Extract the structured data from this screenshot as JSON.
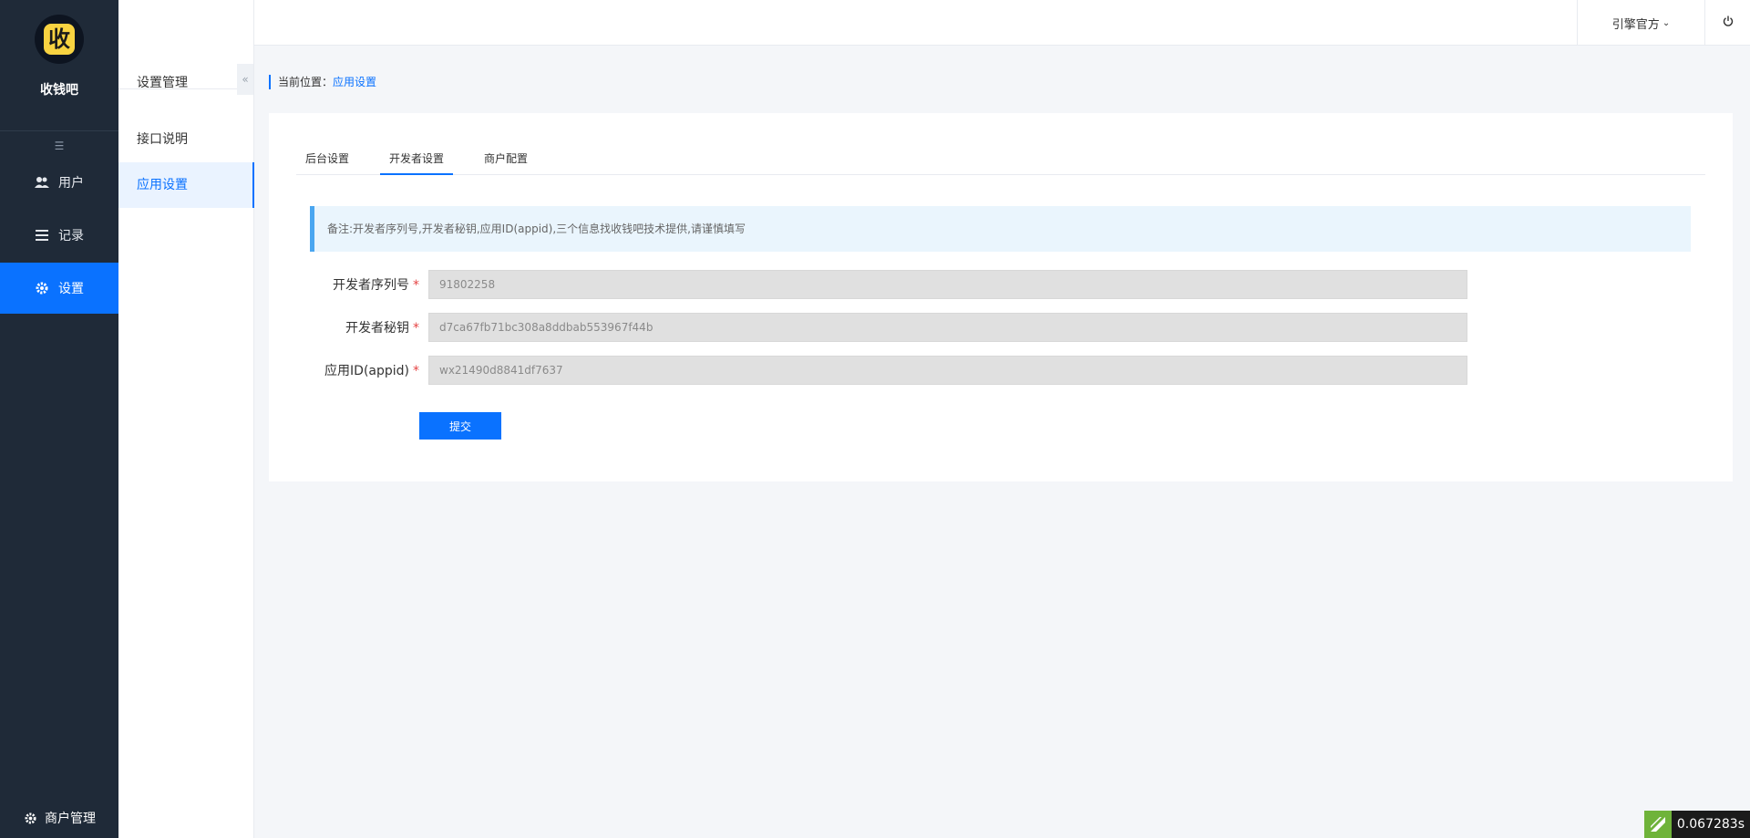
{
  "brand": {
    "logo_char": "收",
    "name": "收钱吧"
  },
  "sidebar": {
    "items": [
      {
        "label": "用户",
        "icon": "users-icon"
      },
      {
        "label": "记录",
        "icon": "list-icon"
      },
      {
        "label": "设置",
        "icon": "gear-icon",
        "active": true
      }
    ],
    "bottom_label": "商户管理"
  },
  "subnav": {
    "title": "设置管理",
    "items": [
      {
        "label": "接口说明"
      },
      {
        "label": "应用设置",
        "active": true
      }
    ]
  },
  "topbar": {
    "user": "引擎官方"
  },
  "breadcrumb": {
    "prefix": "当前位置：",
    "current": "应用设置"
  },
  "tabs": [
    {
      "label": "后台设置"
    },
    {
      "label": "开发者设置",
      "active": true
    },
    {
      "label": "商户配置"
    }
  ],
  "notice": "备注:开发者序列号,开发者秘钥,应用ID(appid),三个信息找收钱吧技术提供,请谨慎填写",
  "form": {
    "fields": [
      {
        "label": "开发者序列号",
        "value": "91802258"
      },
      {
        "label": "开发者秘钥",
        "value": "d7ca67fb71bc308a8ddbab553967f44b"
      },
      {
        "label": "应用ID(appid)",
        "value": "wx21490d8841df7637"
      }
    ],
    "required_mark": "*",
    "submit_label": "提交"
  },
  "timer": "0.067283s",
  "colors": {
    "sidebar_bg": "#1f2a38",
    "accent": "#0a72ff",
    "notice_bg": "#eaf5fd"
  }
}
